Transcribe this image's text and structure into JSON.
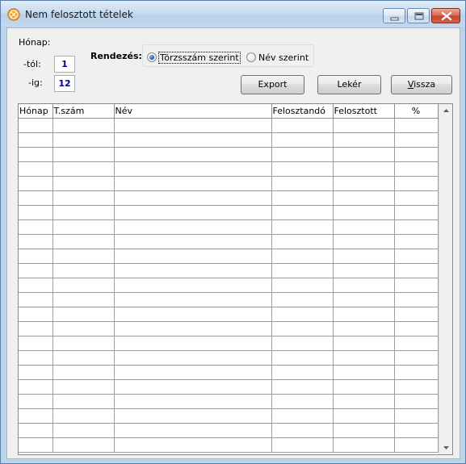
{
  "window": {
    "title": "Nem felosztott tételek",
    "app_icon": "app-logo-icon",
    "controls": [
      "minimize-icon",
      "maximize-icon",
      "close-icon"
    ]
  },
  "filter": {
    "month_label": "Hónap:",
    "from_label": "-tól:",
    "from_value": "1",
    "to_label": "-ig:",
    "to_value": "12"
  },
  "sort": {
    "label": "Rendezés:",
    "options": [
      {
        "label": "Törzsszám szerint",
        "selected": true
      },
      {
        "label": "Név szerint",
        "selected": false
      }
    ]
  },
  "buttons": {
    "export": "Export",
    "leker": "Lekér",
    "vissza_underlined": "V",
    "vissza_rest": "issza"
  },
  "table": {
    "columns": [
      "Hónap",
      "T.szám",
      "Név",
      "Felosztandó",
      "Felosztott",
      "%"
    ],
    "rows": [
      [
        "",
        "",
        "",
        "",
        "",
        ""
      ],
      [
        "",
        "",
        "",
        "",
        "",
        ""
      ],
      [
        "",
        "",
        "",
        "",
        "",
        ""
      ],
      [
        "",
        "",
        "",
        "",
        "",
        ""
      ],
      [
        "",
        "",
        "",
        "",
        "",
        ""
      ],
      [
        "",
        "",
        "",
        "",
        "",
        ""
      ],
      [
        "",
        "",
        "",
        "",
        "",
        ""
      ],
      [
        "",
        "",
        "",
        "",
        "",
        ""
      ],
      [
        "",
        "",
        "",
        "",
        "",
        ""
      ],
      [
        "",
        "",
        "",
        "",
        "",
        ""
      ],
      [
        "",
        "",
        "",
        "",
        "",
        ""
      ],
      [
        "",
        "",
        "",
        "",
        "",
        ""
      ],
      [
        "",
        "",
        "",
        "",
        "",
        ""
      ],
      [
        "",
        "",
        "",
        "",
        "",
        ""
      ],
      [
        "",
        "",
        "",
        "",
        "",
        ""
      ],
      [
        "",
        "",
        "",
        "",
        "",
        ""
      ],
      [
        "",
        "",
        "",
        "",
        "",
        ""
      ],
      [
        "",
        "",
        "",
        "",
        "",
        ""
      ],
      [
        "",
        "",
        "",
        "",
        "",
        ""
      ],
      [
        "",
        "",
        "",
        "",
        "",
        ""
      ],
      [
        "",
        "",
        "",
        "",
        "",
        ""
      ],
      [
        "",
        "",
        "",
        "",
        "",
        ""
      ],
      [
        "",
        "",
        "",
        "",
        "",
        ""
      ]
    ]
  },
  "colors": {
    "input_text": "#00008b",
    "radio_selected": "#1a5fb4"
  }
}
